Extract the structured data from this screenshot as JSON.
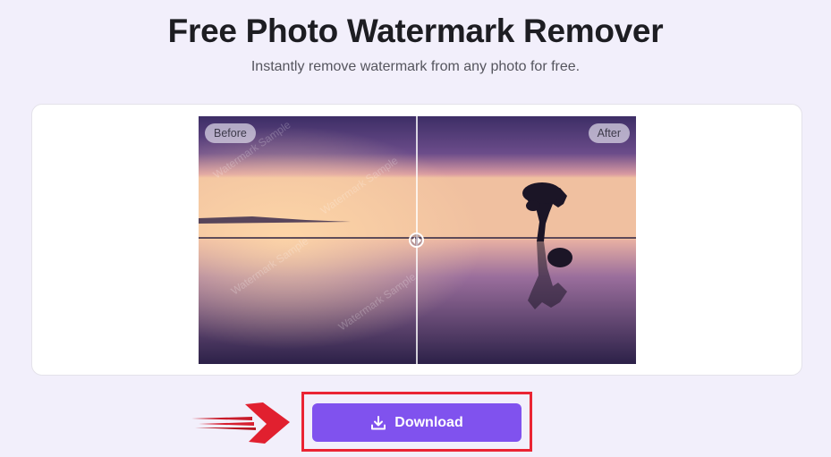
{
  "header": {
    "title": "Free Photo Watermark Remover",
    "subtitle": "Instantly remove watermark from any photo for free."
  },
  "comparison": {
    "before_label": "Before",
    "after_label": "After",
    "slider_position_percent": 50,
    "watermark_text": "Watermark Sample"
  },
  "actions": {
    "download_label": "Download",
    "download_icon": "download-icon"
  },
  "annotation": {
    "highlight_color": "#ea2433",
    "arrow_icon": "arrow-right-icon"
  },
  "colors": {
    "accent": "#8052ee",
    "background": "#f2effb"
  }
}
